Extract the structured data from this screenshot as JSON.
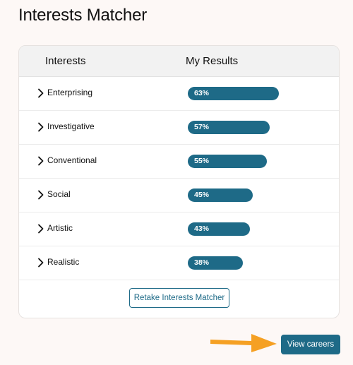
{
  "page": {
    "title": "Interests Matcher"
  },
  "table": {
    "columns": [
      "Interests",
      "My Results"
    ],
    "rows": [
      {
        "label": "Enterprising",
        "percent_text": "63%",
        "value": 63
      },
      {
        "label": "Investigative",
        "percent_text": "57%",
        "value": 57
      },
      {
        "label": "Conventional",
        "percent_text": "55%",
        "value": 55
      },
      {
        "label": "Social",
        "percent_text": "45%",
        "value": 45
      },
      {
        "label": "Artistic",
        "percent_text": "43%",
        "value": 43
      },
      {
        "label": "Realistic",
        "percent_text": "38%",
        "value": 38
      }
    ]
  },
  "actions": {
    "retake_label": "Retake Interests Matcher",
    "view_careers_label": "View careers"
  },
  "icons": {
    "row_expand": "chevron-right-icon",
    "pointer": "arrow-right-icon"
  },
  "colors": {
    "accent": "#1e6a87",
    "arrow": "#f5a023",
    "background": "#fdf8f6"
  }
}
